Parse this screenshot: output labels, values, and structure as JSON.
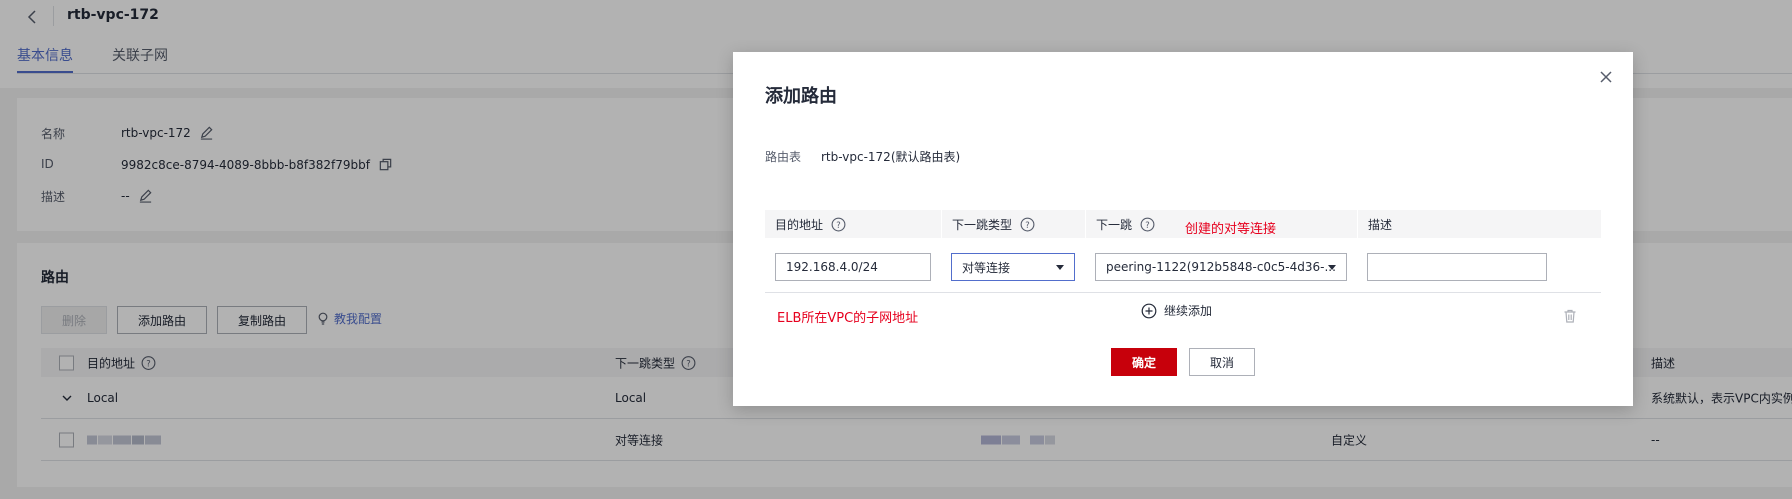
{
  "header": {
    "back_icon": "chevron-left-icon",
    "title": "rtb-vpc-172",
    "tabs": [
      {
        "label": "基本信息",
        "active": true
      },
      {
        "label": "关联子网",
        "active": false
      }
    ]
  },
  "info": {
    "name_label": "名称",
    "name_value": "rtb-vpc-172",
    "id_label": "ID",
    "id_value": "9982c8ce-8794-4089-8bbb-b8f382f79bbf",
    "desc_label": "描述",
    "desc_value": "--"
  },
  "routes": {
    "title": "路由",
    "delete_label": "删除",
    "add_label": "添加路由",
    "copy_label": "复制路由",
    "guide_link": "教我配置",
    "columns": {
      "dest": "目的地址",
      "nexthop_type": "下一跳类型",
      "description": "描述"
    },
    "rows": [
      {
        "dest": "Local",
        "nexthop_type": "Local",
        "route_type": "",
        "description": "系统默认，表示VPC内实例"
      },
      {
        "dest": "",
        "nexthop_type": "对等连接",
        "route_type": "自定义",
        "description": "--"
      }
    ]
  },
  "modal": {
    "title": "添加路由",
    "route_table_label": "路由表",
    "route_table_value": "rtb-vpc-172(默认路由表)",
    "columns": {
      "dest": "目的地址",
      "nexthop_type": "下一跳类型",
      "nexthop": "下一跳",
      "description": "描述"
    },
    "row": {
      "dest_value": "192.168.4.0/24",
      "nexthop_type_value": "对等连接",
      "nexthop_value": "peering-1122(912b5848-c0c5-4d36-...",
      "description_value": ""
    },
    "add_more_label": "继续添加",
    "confirm_label": "确定",
    "cancel_label": "取消"
  },
  "annotations": {
    "nexthop_note": "创建的对等连接",
    "dest_note": "ELB所在VPC的子网地址"
  },
  "colors": {
    "primary": "#526ecc",
    "confirm": "#c7000b",
    "annotation": "#e6001e"
  }
}
